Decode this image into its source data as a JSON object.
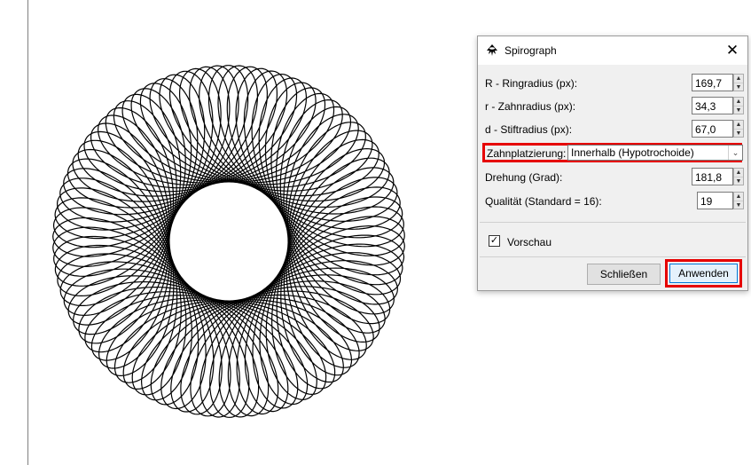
{
  "dialog": {
    "title": "Spirograph",
    "close_glyph": "✕",
    "fields": {
      "ring_radius": {
        "label": "R - Ringradius (px):",
        "value": "169,7"
      },
      "gear_radius": {
        "label": "r - Zahnradius (px):",
        "value": "34,3"
      },
      "pen_radius": {
        "label": "d - Stiftradius (px):",
        "value": "67,0"
      },
      "gear_placement": {
        "label": "Zahnplatzierung:",
        "value": "Innerhalb (Hypotrochoide)"
      },
      "rotation": {
        "label": "Drehung (Grad):",
        "value": "181,8"
      },
      "quality": {
        "label": "Qualität (Standard = 16):",
        "value": "19"
      }
    },
    "preview": {
      "label": "Vorschau",
      "checked": true,
      "check_glyph": "✓"
    },
    "buttons": {
      "close": "Schließen",
      "apply": "Anwenden"
    },
    "spin_up": "▲",
    "spin_down": "▼",
    "dropdown_arrow": "⌄"
  },
  "icons": {
    "app": "inkscape-icon",
    "close": "close-icon",
    "checkbox": "checkmark-icon"
  },
  "colors": {
    "highlight": "#e60000",
    "dialog_bg": "#f0f0f0",
    "curve": "#000000"
  }
}
